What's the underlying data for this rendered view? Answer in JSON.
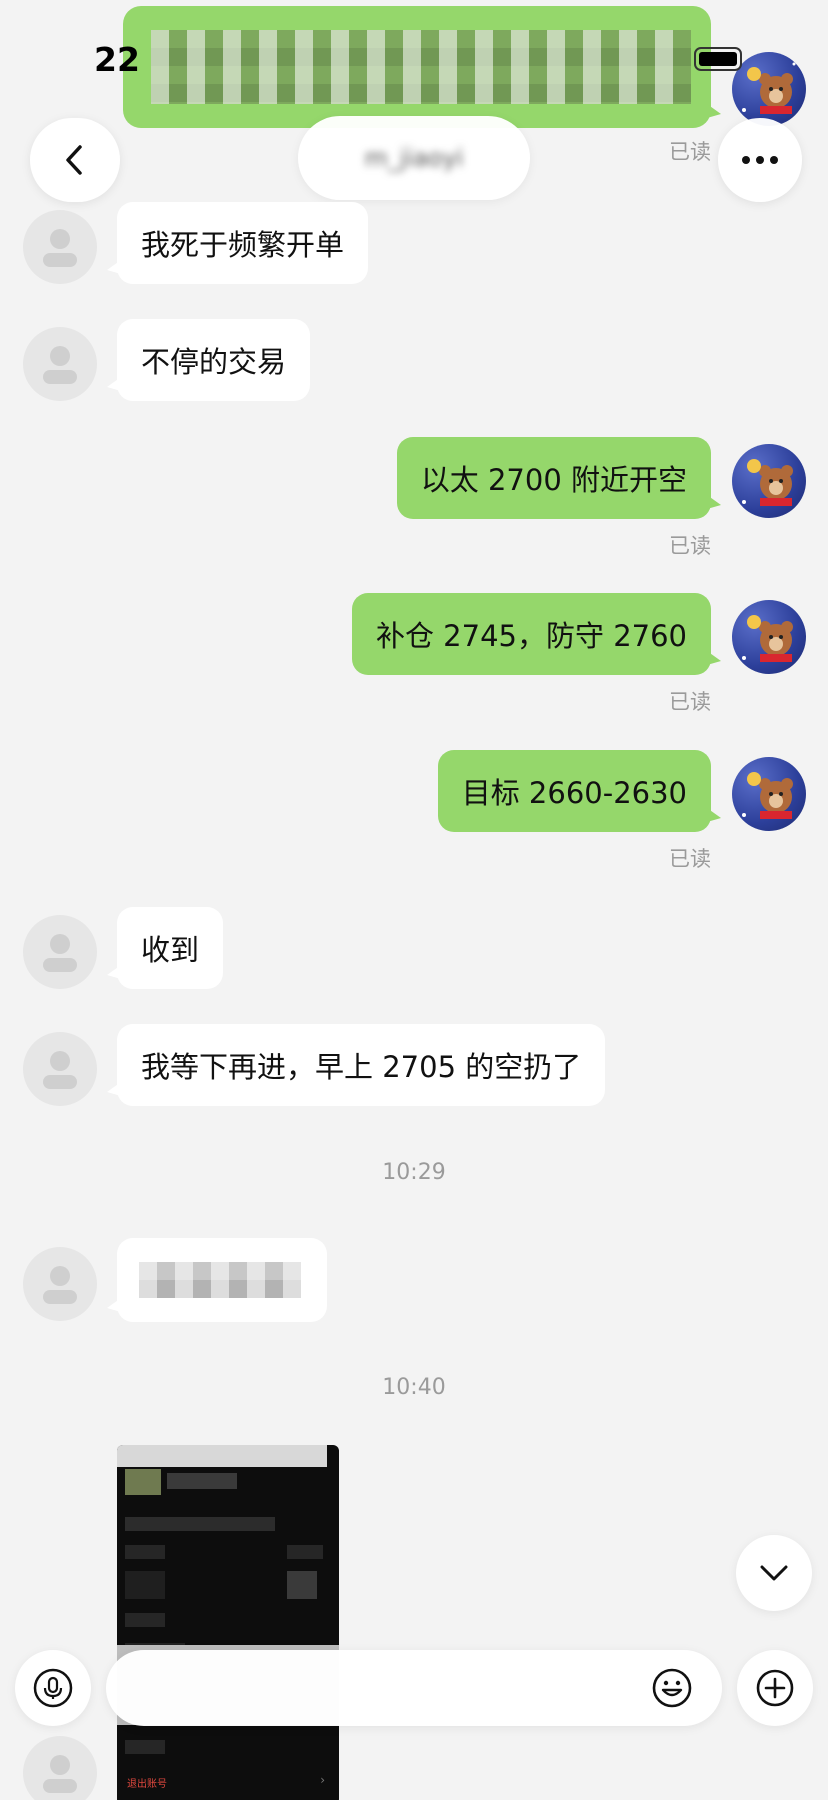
{
  "status_bar": {
    "time": "22"
  },
  "header": {
    "title_redacted": "m_jiaoyi",
    "back_icon": "chevron-left-icon",
    "more_icon": "more-horizontal-icon"
  },
  "messages": [
    {
      "side": "in",
      "text": "我死于频繁开单"
    },
    {
      "side": "in",
      "text": "不停的交易"
    },
    {
      "side": "out",
      "text": "以太 2700 附近开空",
      "status": "已读"
    },
    {
      "side": "out",
      "text": "补仓 2745，防守 2760",
      "status": "已读"
    },
    {
      "side": "out",
      "text": "目标 2660-2630",
      "status": "已读"
    },
    {
      "side": "in",
      "text": "收到"
    },
    {
      "side": "in",
      "text": "我等下再进，早上 2705 的空扔了"
    }
  ],
  "top_read_status": "已读",
  "timestamps": [
    "10:29",
    "10:40"
  ],
  "image_message": {
    "footer_text": "退出账号",
    "footer_chevron": "›"
  },
  "input_bar": {
    "voice_icon": "microphone-icon",
    "emoji_icon": "emoji-icon",
    "add_icon": "plus-circle-icon"
  },
  "scroll_down_icon": "chevron-down-icon",
  "colors": {
    "background": "#f3f3f3",
    "bubble_out": "#95d76b",
    "bubble_in": "#ffffff",
    "meta_text": "#9a9a9a"
  }
}
